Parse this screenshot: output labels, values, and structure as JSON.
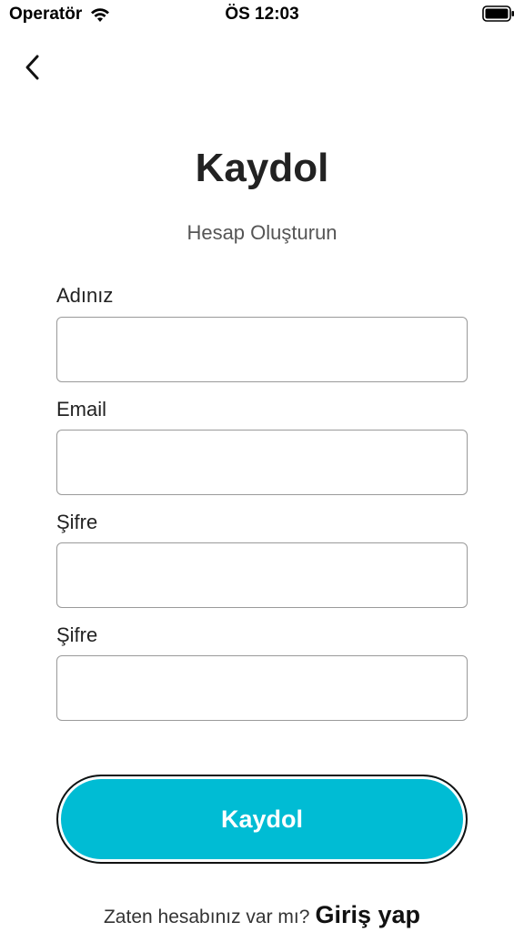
{
  "status_bar": {
    "carrier": "Operatör",
    "time": "ÖS 12:03",
    "wifi_icon": "wifi-icon",
    "battery_icon": "battery-icon"
  },
  "nav": {
    "back_icon": "chevron-left-icon"
  },
  "header": {
    "title": "Kaydol",
    "subtitle": "Hesap Oluşturun"
  },
  "form": {
    "fields": [
      {
        "label": "Adınız",
        "value": "",
        "placeholder": ""
      },
      {
        "label": "Email",
        "value": "",
        "placeholder": ""
      },
      {
        "label": "Şifre",
        "value": "",
        "placeholder": ""
      },
      {
        "label": "Şifre",
        "value": "",
        "placeholder": ""
      }
    ],
    "submit_label": "Kaydol"
  },
  "footer": {
    "prompt": "Zaten hesabınız var mı?",
    "link_label": "Giriş yap"
  },
  "colors": {
    "primary": "#00bcd4",
    "text": "#222222",
    "muted": "#555555",
    "border": "#9a9a9a"
  }
}
